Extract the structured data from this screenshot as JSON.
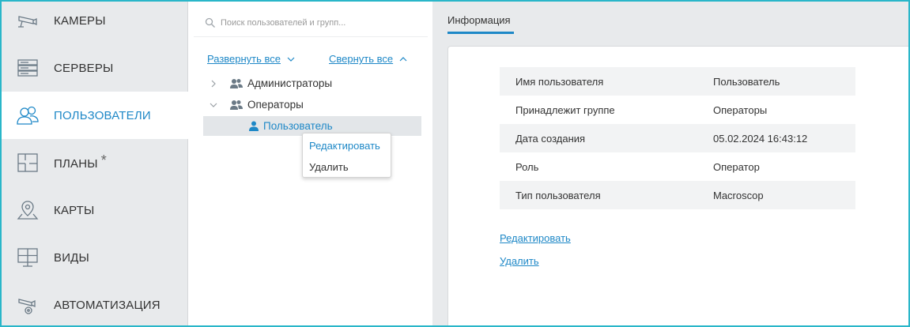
{
  "sidebar": {
    "items": [
      {
        "label": "КАМЕРЫ",
        "icon": "camera-icon",
        "active": false
      },
      {
        "label": "СЕРВЕРЫ",
        "icon": "server-icon",
        "active": false
      },
      {
        "label": "ПОЛЬЗОВАТЕЛИ",
        "icon": "users-icon",
        "active": true
      },
      {
        "label": "ПЛАНЫ",
        "icon": "plan-icon",
        "active": false,
        "badge": "*"
      },
      {
        "label": "КАРТЫ",
        "icon": "map-pin-icon",
        "active": false
      },
      {
        "label": "ВИДЫ",
        "icon": "monitor-icon",
        "active": false
      },
      {
        "label": "АВТОМАТИЗАЦИЯ",
        "icon": "automation-icon",
        "active": false
      }
    ]
  },
  "tree": {
    "search_placeholder": "Поиск пользователей и групп...",
    "expand_all": "Развернуть все",
    "collapse_all": "Свернуть все",
    "nodes": [
      {
        "label": "Администраторы",
        "type": "group",
        "expanded": false
      },
      {
        "label": "Операторы",
        "type": "group",
        "expanded": true
      },
      {
        "label": "Пользователь",
        "type": "user",
        "selected": true
      }
    ],
    "context_menu": {
      "edit": "Редактировать",
      "delete": "Удалить"
    }
  },
  "details": {
    "tab": "Информация",
    "rows": [
      {
        "key": "Имя пользователя",
        "value": "Пользователь"
      },
      {
        "key": "Принадлежит группе",
        "value": "Операторы"
      },
      {
        "key": "Дата создания",
        "value": "05.02.2024 16:43:12"
      },
      {
        "key": "Роль",
        "value": "Оператор"
      },
      {
        "key": "Тип пользователя",
        "value": "Macroscop"
      }
    ],
    "edit_link": "Редактировать",
    "delete_link": "Удалить"
  },
  "colors": {
    "accent": "#1e88c7",
    "frame": "#29b6c9",
    "sidebar_bg": "#e8eaec"
  }
}
